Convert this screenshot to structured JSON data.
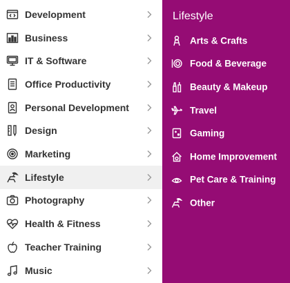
{
  "colors": {
    "submenu_bg": "#950c74",
    "active_row_bg": "#f0f0f0",
    "label_text": "#333333",
    "chevron": "#999999"
  },
  "categories": [
    {
      "label": "Development",
      "icon": "code-window-icon"
    },
    {
      "label": "Business",
      "icon": "bar-chart-icon"
    },
    {
      "label": "IT & Software",
      "icon": "monitor-icon"
    },
    {
      "label": "Office Productivity",
      "icon": "document-icon"
    },
    {
      "label": "Personal Development",
      "icon": "person-badge-icon"
    },
    {
      "label": "Design",
      "icon": "pen-ruler-icon"
    },
    {
      "label": "Marketing",
      "icon": "target-icon"
    },
    {
      "label": "Lifestyle",
      "icon": "beach-chair-icon",
      "active": true
    },
    {
      "label": "Photography",
      "icon": "camera-icon"
    },
    {
      "label": "Health & Fitness",
      "icon": "heartbeat-icon"
    },
    {
      "label": "Teacher Training",
      "icon": "apple-icon"
    },
    {
      "label": "Music",
      "icon": "music-note-icon"
    }
  ],
  "submenu": {
    "title": "Lifestyle",
    "items": [
      {
        "label": "Arts & Crafts",
        "icon": "crafts-icon"
      },
      {
        "label": "Food & Beverage",
        "icon": "plate-icon"
      },
      {
        "label": "Beauty & Makeup",
        "icon": "makeup-icon"
      },
      {
        "label": "Travel",
        "icon": "airplane-icon"
      },
      {
        "label": "Gaming",
        "icon": "gamepad-icon"
      },
      {
        "label": "Home Improvement",
        "icon": "home-icon"
      },
      {
        "label": "Pet Care & Training",
        "icon": "paw-icon"
      },
      {
        "label": "Other",
        "icon": "beach-chair-icon"
      }
    ]
  }
}
